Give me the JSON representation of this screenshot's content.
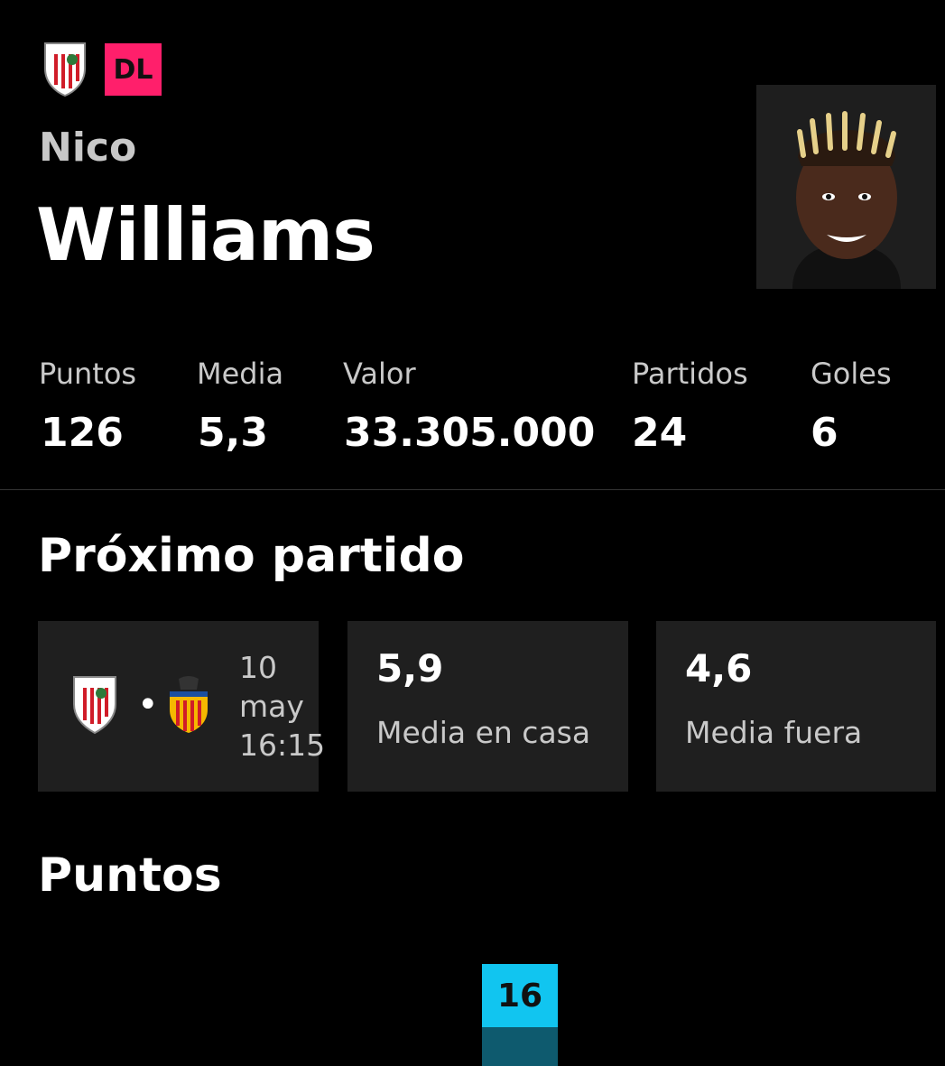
{
  "player": {
    "position_badge": "DL",
    "first_name": "Nico",
    "last_name": "Williams",
    "club_crest_text": "ATHLETIC CLUB",
    "badge_color": "#ff1f6b"
  },
  "stats": [
    {
      "label": "Puntos",
      "value": "126"
    },
    {
      "label": "Media",
      "value": "5,3"
    },
    {
      "label": "Valor",
      "value": "33.305.000"
    },
    {
      "label": "Partidos",
      "value": "24"
    },
    {
      "label": "Goles",
      "value": "6"
    }
  ],
  "next_match": {
    "title": "Próximo partido",
    "separator": "•",
    "date_day": "10",
    "date_month": "may",
    "time": "16:15",
    "home_crest_icon": "athletic-club-crest",
    "away_crest_icon": "valencia-cf-crest",
    "home_avg_value": "5,9",
    "home_avg_label": "Media en casa",
    "away_avg_value": "4,6",
    "away_avg_label": "Media fuera"
  },
  "points_section": {
    "title": "Puntos",
    "bar_value": "16",
    "bar_color": "#11c5f0"
  }
}
